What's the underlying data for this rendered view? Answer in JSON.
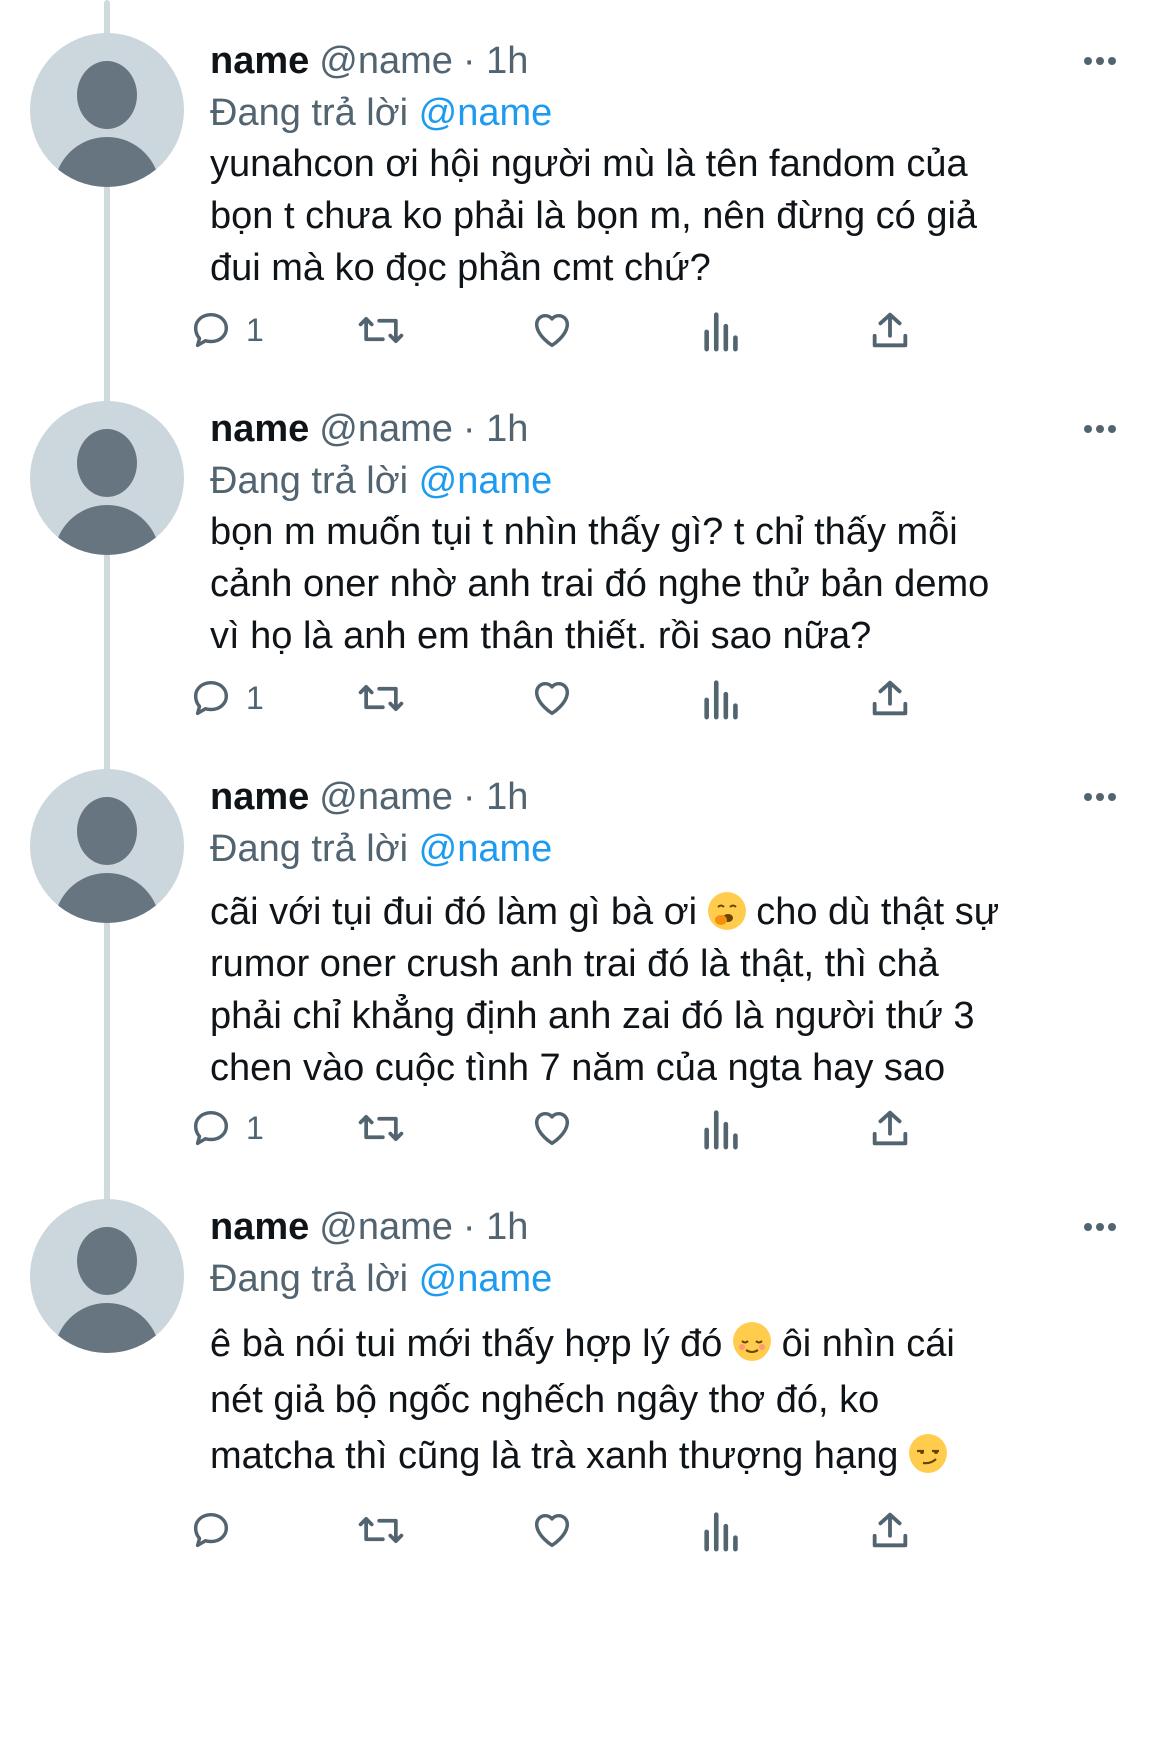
{
  "tweets": [
    {
      "name": "name",
      "handle": "@name",
      "time": "· 1h",
      "reply_prefix": "Đang trả lời",
      "reply_to": "@name",
      "lines": [
        "yunahcon ơi hội người mù là tên fandom của",
        "bọn t chưa ko phải là bọn m, nên đừng có giả",
        "đui mà ko đọc phần cmt chứ?"
      ],
      "reply_count": "1"
    },
    {
      "name": "name",
      "handle": "@name",
      "time": "· 1h",
      "reply_prefix": "Đang trả lời",
      "reply_to": "@name",
      "lines": [
        "bọn m muốn tụi t nhìn thấy gì? t chỉ thấy mỗi",
        "cảnh oner nhờ anh trai đó nghe thử bản demo",
        "vì họ là anh em thân thiết. rồi sao nữa?"
      ],
      "reply_count": "1"
    },
    {
      "name": "name",
      "handle": "@name",
      "time": "· 1h",
      "reply_prefix": "Đang trả lời",
      "reply_to": "@name",
      "line1_a": "cãi với tụi đui đó làm gì bà ơi",
      "line1_emoji": "yawning-face-emoji",
      "line1_b": "cho dù thật sự",
      "lines_rest": [
        "rumor oner crush anh trai đó là thật, thì chả",
        "phải chỉ khẳng định anh zai đó là người thứ 3",
        "chen vào cuộc tình 7 năm của ngta hay sao"
      ],
      "reply_count": "1"
    },
    {
      "name": "name",
      "handle": "@name",
      "time": "· 1h",
      "reply_prefix": "Đang trả lời",
      "reply_to": "@name",
      "line1_a": "ê bà nói tui mới thấy hợp lý đó",
      "line1_emoji": "relieved-face-emoji",
      "line1_b": "ôi nhìn cái",
      "line2": "nét giả bộ ngốc nghếch ngây thơ đó, ko",
      "line3_a": "matcha thì cũng là trà xanh thượng hạng",
      "line3_emoji": "smirking-face-emoji",
      "reply_count": ""
    }
  ],
  "colors": {
    "text": "#0f1419",
    "secondary": "#536471",
    "link": "#1d9bf0",
    "avatar_bg": "#ccd6dd",
    "avatar_fg": "#66757f",
    "thread_line": "#cfd9de"
  },
  "icons": [
    "reply-icon",
    "retweet-icon",
    "like-icon",
    "analytics-icon",
    "share-icon",
    "more-icon"
  ]
}
